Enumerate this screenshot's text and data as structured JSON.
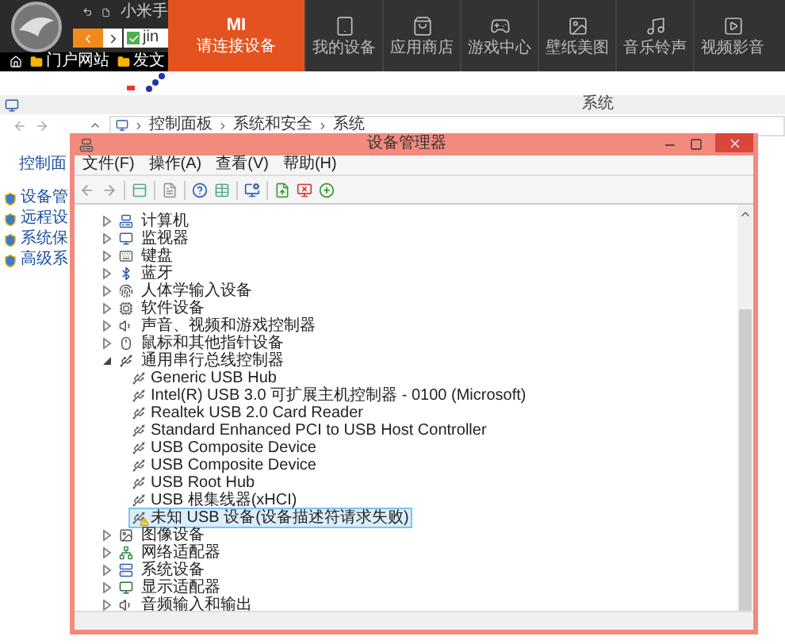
{
  "browser": {
    "tab_title": "小米手",
    "address": "jin",
    "bookmarks": [
      "门户网站",
      "发文"
    ]
  },
  "phone_assistant": {
    "tabs": [
      {
        "kind": "logo",
        "logo": "MI",
        "label": "请连接设备",
        "selected": true
      },
      {
        "kind": "icon",
        "label": "我的设备",
        "selected": false
      },
      {
        "kind": "icon",
        "label": "应用商店",
        "selected": false
      },
      {
        "kind": "icon",
        "label": "游戏中心",
        "selected": false
      },
      {
        "kind": "icon",
        "label": "壁纸美图",
        "selected": false
      },
      {
        "kind": "icon",
        "label": "音乐铃声",
        "selected": false
      },
      {
        "kind": "icon",
        "label": "视频影音",
        "selected": false
      }
    ]
  },
  "system_window": {
    "title": "系统",
    "breadcrumb": [
      "控制面板",
      "系统和安全",
      "系统"
    ],
    "sidebar": {
      "home_link": "控制面",
      "links": [
        "设备管",
        "远程设",
        "系统保",
        "高级系"
      ]
    }
  },
  "device_manager": {
    "title": "设备管理器",
    "menu": [
      "文件(F)",
      "操作(A)",
      "查看(V)",
      "帮助(H)"
    ],
    "tree": [
      {
        "label": "计算机",
        "expanded": false,
        "selected": false
      },
      {
        "label": "监视器",
        "expanded": false,
        "selected": false
      },
      {
        "label": "键盘",
        "expanded": false,
        "selected": false
      },
      {
        "label": "蓝牙",
        "expanded": false,
        "selected": false
      },
      {
        "label": "人体学输入设备",
        "expanded": false,
        "selected": false
      },
      {
        "label": "软件设备",
        "expanded": false,
        "selected": false
      },
      {
        "label": "声音、视频和游戏控制器",
        "expanded": false,
        "selected": false
      },
      {
        "label": "鼠标和其他指针设备",
        "expanded": false,
        "selected": false
      },
      {
        "label": "通用串行总线控制器",
        "expanded": true,
        "selected": false,
        "children": [
          {
            "label": "Generic USB Hub",
            "selected": false,
            "warning": false
          },
          {
            "label": "Intel(R) USB 3.0 可扩展主机控制器 - 0100 (Microsoft)",
            "selected": false,
            "warning": false
          },
          {
            "label": "Realtek USB 2.0 Card Reader",
            "selected": false,
            "warning": false
          },
          {
            "label": "Standard Enhanced PCI to USB Host Controller",
            "selected": false,
            "warning": false
          },
          {
            "label": "USB Composite Device",
            "selected": false,
            "warning": false
          },
          {
            "label": "USB Composite Device",
            "selected": false,
            "warning": false
          },
          {
            "label": "USB Root Hub",
            "selected": false,
            "warning": false
          },
          {
            "label": "USB 根集线器(xHCI)",
            "selected": false,
            "warning": false
          },
          {
            "label": "未知 USB 设备(设备描述符请求失败)",
            "selected": true,
            "warning": true
          }
        ]
      },
      {
        "label": "图像设备",
        "expanded": false,
        "selected": false
      },
      {
        "label": "网络适配器",
        "expanded": false,
        "selected": false
      },
      {
        "label": "系统设备",
        "expanded": false,
        "selected": false
      },
      {
        "label": "显示适配器",
        "expanded": false,
        "selected": false
      },
      {
        "label": "音频输入和输出",
        "expanded": false,
        "selected": false
      }
    ]
  }
}
